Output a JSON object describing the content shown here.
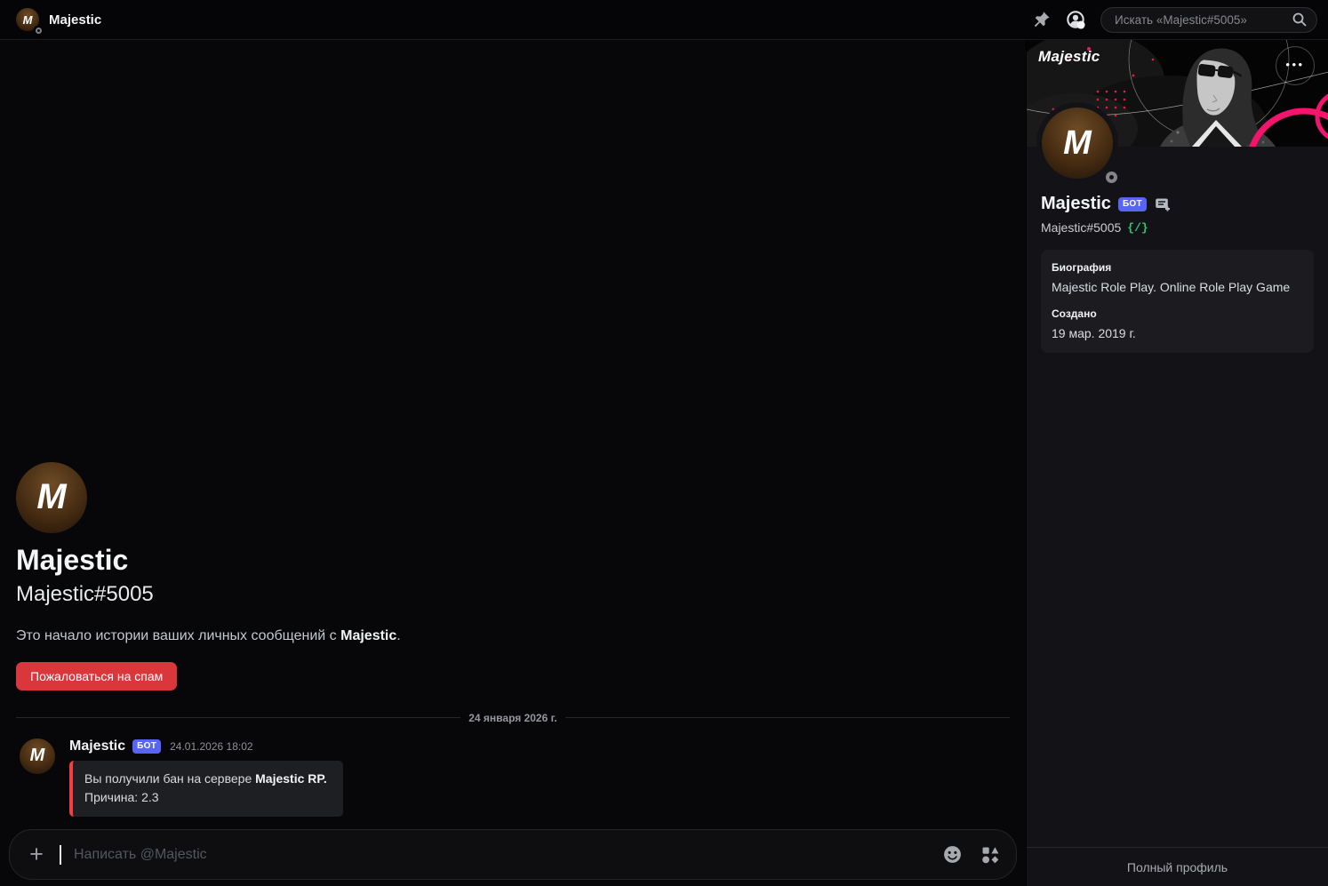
{
  "topbar": {
    "app_title": "Majestic",
    "avatar_letter": "M",
    "search_placeholder": "Искать «Majestic#5005»"
  },
  "chat": {
    "welcome": {
      "avatar_letter": "M",
      "title": "Majestic",
      "subtitle": "Majestic#5005",
      "intro_prefix": "Это начало истории ваших личных сообщений с ",
      "intro_bold": "Majestic",
      "intro_suffix": ".",
      "report_button": "Пожаловаться на спам"
    },
    "date_divider": "24 января 2026 г.",
    "message": {
      "avatar_letter": "M",
      "author": "Majestic",
      "bot_badge": "БОТ",
      "timestamp": "24.01.2026 18:02",
      "embed": {
        "line1_prefix": "Вы получили бан на сервере ",
        "line1_bold": "Majestic RP",
        "line1_suffix": ".",
        "line2": "Причина: 2.3"
      }
    },
    "composer": {
      "placeholder": "Написать @Majestic"
    }
  },
  "profile_panel": {
    "banner_logo": "Majestic",
    "avatar_letter": "M",
    "name": "Majestic",
    "bot_badge": "БОТ",
    "tag": "Majestic#5005",
    "slash_badge": "{/}",
    "about": {
      "bio_label": "Биография",
      "bio_text": "Majestic Role Play. Online Role Play Game",
      "created_label": "Создано",
      "created_value": "19 мар. 2019 г."
    },
    "footer_link": "Полный профиль"
  },
  "icons": {
    "more_dots": "•••",
    "plus": "+"
  },
  "colors": {
    "accent_blurple": "#5865f2",
    "danger_red": "#da373c",
    "embed_border_red": "#f23f43",
    "slash_green": "#2dc770",
    "banner_pink": "#f3146e",
    "offline_gray": "#83858a"
  }
}
